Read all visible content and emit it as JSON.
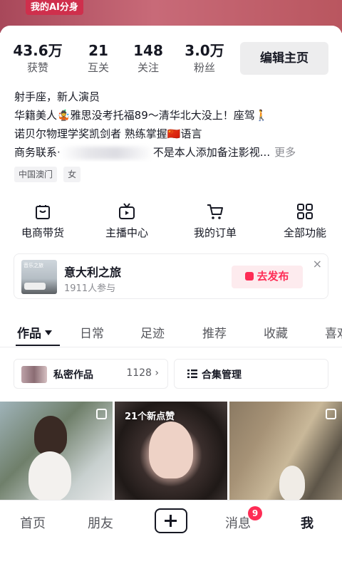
{
  "banner": {
    "ai_badge": "我的AI分身"
  },
  "stats": [
    {
      "value": "43.6万",
      "label": "获赞"
    },
    {
      "value": "21",
      "label": "互关"
    },
    {
      "value": "148",
      "label": "关注"
    },
    {
      "value": "3.0万",
      "label": "粉丝"
    }
  ],
  "edit_button": "编辑主页",
  "bio": {
    "line1": "射手座，新人演员",
    "line2": "华籍美人🤹雅思没考托福89～清华北大没上！座驾🚶",
    "line3": "诺贝尔物理学奖凯剑者  熟练掌握🇨🇳语言",
    "line4_prefix": "商务联系·",
    "line4_suffix": "不是本人添加备注影视...",
    "more": "更多"
  },
  "tags": [
    "中国澳门",
    "女"
  ],
  "features": [
    {
      "icon": "shopping-bag-icon",
      "label": "电商带货"
    },
    {
      "icon": "tv-icon",
      "label": "主播中心"
    },
    {
      "icon": "cart-icon",
      "label": "我的订单"
    },
    {
      "icon": "grid-icon",
      "label": "全部功能"
    }
  ],
  "topic": {
    "title": "意大利之旅",
    "subtitle": "1911人参与",
    "publish": "去发布",
    "close": "×"
  },
  "tabs": [
    {
      "label": "作品",
      "active": true
    },
    {
      "label": "日常"
    },
    {
      "label": "足迹"
    },
    {
      "label": "推荐"
    },
    {
      "label": "收藏"
    },
    {
      "label": "喜欢"
    }
  ],
  "private_works": {
    "label": "私密作品",
    "count": "1128 ›"
  },
  "collection": {
    "label": "合集管理"
  },
  "grid": [
    {
      "overlay": ""
    },
    {
      "overlay": "21个新点赞"
    },
    {
      "overlay": ""
    }
  ],
  "nav": {
    "home": "首页",
    "friends": "朋友",
    "messages": "消息",
    "badge": "9",
    "me": "我"
  },
  "colors": {
    "accent": "#fe2c55",
    "banner": "#c86a78",
    "text": "#161823"
  }
}
